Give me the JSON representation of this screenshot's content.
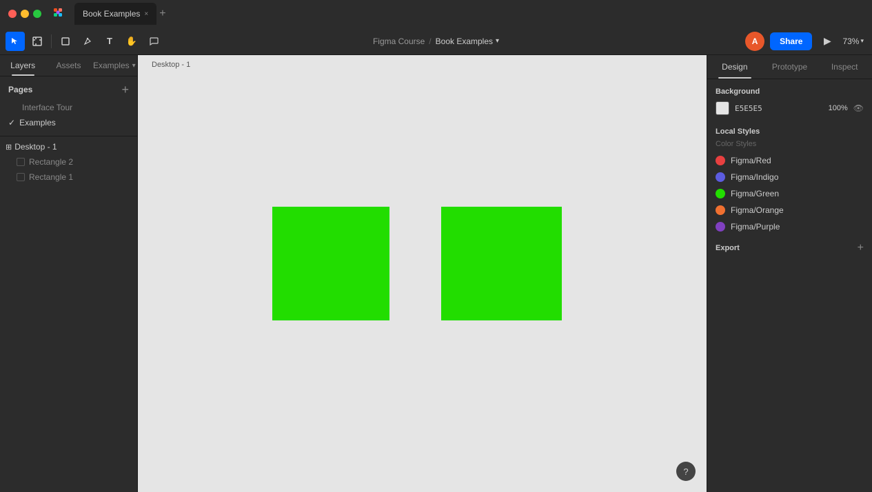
{
  "titlebar": {
    "tab_label": "Book Examples",
    "tab_close": "×",
    "tab_new": "+"
  },
  "toolbar": {
    "breadcrumb_parent": "Figma Course",
    "breadcrumb_sep": "/",
    "breadcrumb_current": "Book Examples",
    "breadcrumb_chevron": "▾",
    "zoom_level": "73%",
    "zoom_chevron": "▾",
    "share_label": "Share",
    "avatar_initials": "A"
  },
  "left_panel": {
    "tab_layers": "Layers",
    "tab_assets": "Assets",
    "tab_examples": "Examples",
    "tab_examples_chevron": "▾",
    "pages_title": "Pages",
    "pages_add": "+",
    "page1_label": "Interface Tour",
    "page2_label": "Examples",
    "page2_active": true,
    "frame_label": "Desktop - 1",
    "layer1_label": "Rectangle 2",
    "layer2_label": "Rectangle 1"
  },
  "canvas": {
    "frame_label": "Desktop - 1",
    "rect1_color": "#22dd00",
    "rect2_color": "#22dd00"
  },
  "right_panel": {
    "tab_design": "Design",
    "tab_prototype": "Prototype",
    "tab_inspect": "Inspect",
    "background_title": "Background",
    "bg_hex": "E5E5E5",
    "bg_opacity": "100%",
    "local_styles_title": "Local Styles",
    "color_styles_label": "Color Styles",
    "colors": [
      {
        "name": "Figma/Red",
        "color": "#e84040"
      },
      {
        "name": "Figma/Indigo",
        "color": "#5c5ce0"
      },
      {
        "name": "Figma/Green",
        "color": "#22dd00"
      },
      {
        "name": "Figma/Orange",
        "color": "#f07030"
      },
      {
        "name": "Figma/Purple",
        "color": "#8040c0"
      }
    ],
    "export_title": "Export",
    "export_add": "+"
  },
  "help": {
    "label": "?"
  }
}
